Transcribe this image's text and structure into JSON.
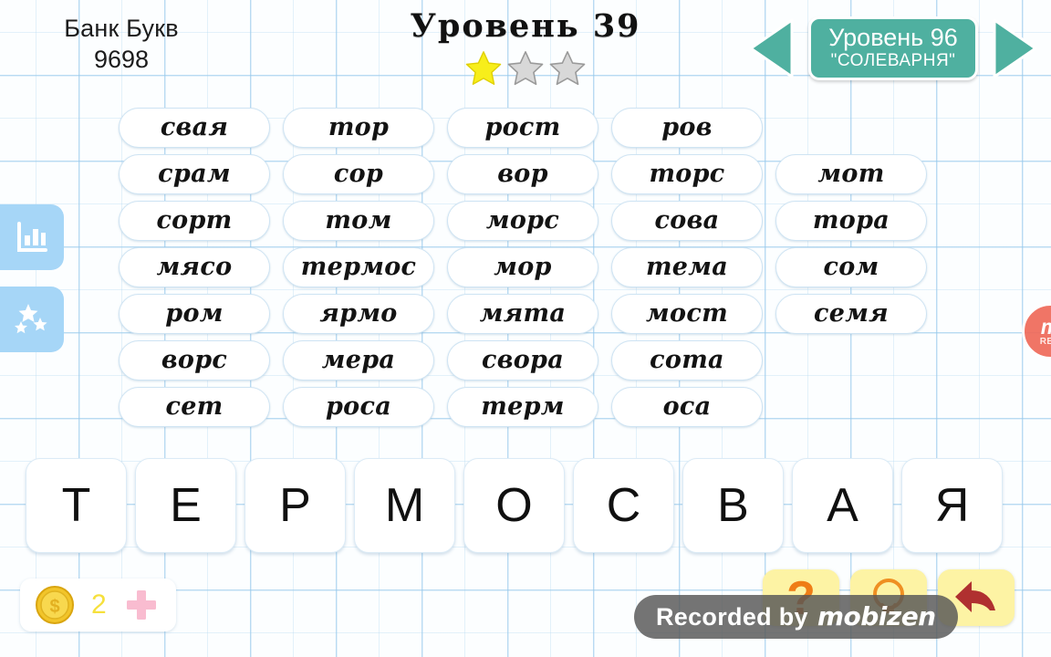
{
  "header": {
    "bank_label": "Банк Букв",
    "bank_value": "9698",
    "level_title": "Уровень 39",
    "stars_total": 3,
    "stars_filled": 1,
    "star_filled_color": "#f7ee1b",
    "star_empty_color": "#d6d6d6",
    "nav": {
      "prev_icon": "left-triangle-icon",
      "next_icon": "right-triangle-icon",
      "arrow_color": "#4fb0a0"
    },
    "level_chip": {
      "main": "Уровень 96",
      "sub": "\"СОЛЕВАРНЯ\"",
      "bg_color": "#4fb0a0"
    }
  },
  "side_tabs": [
    {
      "name": "stats",
      "icon": "bar-chart-icon",
      "color": "#a6d6f7"
    },
    {
      "name": "rating",
      "icon": "stars-icon",
      "color": "#a6d6f7"
    }
  ],
  "word_grid": {
    "rows": [
      [
        "свая",
        "тор",
        "рост",
        "ров",
        ""
      ],
      [
        "срам",
        "сор",
        "вор",
        "торс",
        "мот"
      ],
      [
        "сорт",
        "том",
        "морс",
        "сова",
        "тора"
      ],
      [
        "мясо",
        "термос",
        "мор",
        "тема",
        "сом"
      ],
      [
        "ром",
        "ярмо",
        "мята",
        "мост",
        "семя"
      ],
      [
        "ворс",
        "мера",
        "свора",
        "сота",
        ""
      ],
      [
        "сет",
        "роса",
        "терм",
        "оса",
        ""
      ]
    ]
  },
  "letter_rack": {
    "letters": [
      "Т",
      "Е",
      "Р",
      "М",
      "О",
      "С",
      "В",
      "А",
      "Я"
    ]
  },
  "coin_bar": {
    "coin_icon": "coin-icon",
    "count": "2",
    "plus_icon": "plus-icon",
    "count_color": "#f6e03c",
    "plus_color": "#f9bcd0"
  },
  "actions": [
    {
      "name": "hint",
      "icon": "question-mark-icon",
      "bg": "#fdf3a4"
    },
    {
      "name": "lightbulb",
      "icon": "lightbulb-icon",
      "bg": "#fdf3a4"
    },
    {
      "name": "back",
      "icon": "curved-arrow-icon",
      "bg": "#fdf3a4"
    }
  ],
  "watermark": {
    "text": "Recorded by",
    "brand": "mobizen"
  },
  "rec_float": {
    "mark": "m",
    "label": "REC"
  }
}
